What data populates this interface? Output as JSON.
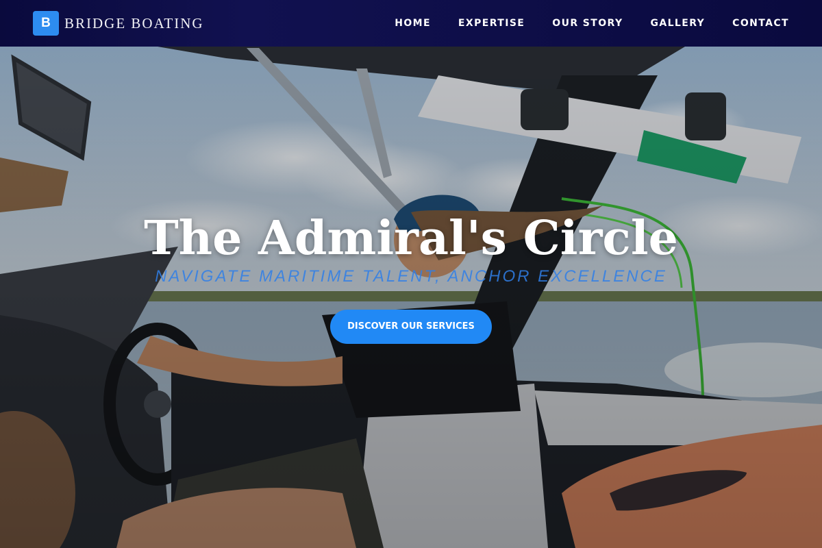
{
  "brand": {
    "badge": "B",
    "name": "BRIDGE BOATING"
  },
  "nav": {
    "items": [
      {
        "label": "HOME"
      },
      {
        "label": "EXPERTISE"
      },
      {
        "label": "OUR STORY"
      },
      {
        "label": "GALLERY"
      },
      {
        "label": "CONTACT"
      }
    ]
  },
  "hero": {
    "title": "The Admiral's Circle",
    "tagline": "NAVIGATE MARITIME TALENT, ANCHOR EXCELLENCE",
    "cta_label": "DISCOVER OUR SERVICES",
    "image_description": "man driving a wakeboard boat on a lake"
  },
  "colors": {
    "nav_bg": "#0a0a3d",
    "accent": "#2189f5",
    "tagline": "#2f7fe8",
    "text": "#ffffff"
  }
}
